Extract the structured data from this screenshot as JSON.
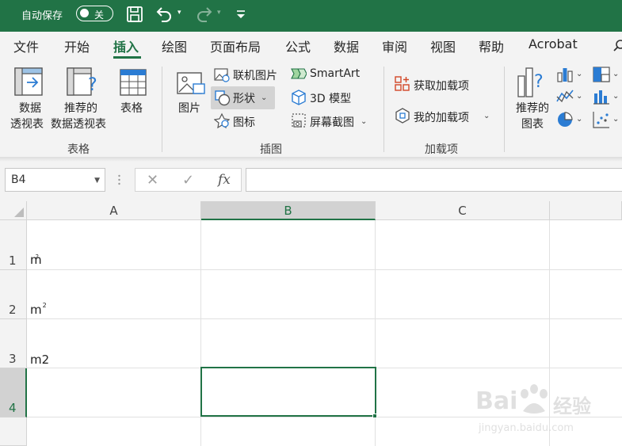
{
  "titlebar": {
    "autosave_label": "自动保存",
    "toggle_state": "关",
    "accent_color": "#217346"
  },
  "menu": {
    "tabs": [
      "文件",
      "开始",
      "插入",
      "绘图",
      "页面布局",
      "公式",
      "数据",
      "审阅",
      "视图",
      "帮助",
      "Acrobat"
    ],
    "active_tab": "插入"
  },
  "ribbon": {
    "tables_group": {
      "label": "表格",
      "pivot_label1": "数据",
      "pivot_label2": "透视表",
      "rec_pivot_label1": "推荐的",
      "rec_pivot_label2": "数据透视表",
      "table_label": "表格"
    },
    "illustrations_group": {
      "label": "插图",
      "picture_label": "图片",
      "online_picture_label": "联机图片",
      "shapes_label": "形状",
      "icons_label": "图标",
      "smartart_label": "SmartArt",
      "model3d_label": "3D 模型",
      "screenshot_label": "屏幕截图"
    },
    "addins_group": {
      "label": "加载项",
      "get_addins_label": "获取加载项",
      "my_addins_label": "我的加载项"
    },
    "charts_group": {
      "rec_charts_label1": "推荐的",
      "rec_charts_label2": "图表"
    }
  },
  "formula_bar": {
    "name_box": "B4",
    "cancel_symbol": "✕",
    "enter_symbol": "✓",
    "fx_symbol": "fx",
    "formula_value": ""
  },
  "grid": {
    "columns": [
      "A",
      "B",
      "C"
    ],
    "selected_column": "B",
    "rows": [
      "1",
      "2",
      "3",
      "4"
    ],
    "selected_row": "4",
    "cells": {
      "A1_base": "m",
      "A1_sup": "2",
      "A2_base": "m",
      "A2_sup": "2",
      "A3": "m2"
    }
  },
  "watermark": {
    "brand": "Bai",
    "brand2": "经验",
    "url": "jingyan.baidu.com"
  }
}
